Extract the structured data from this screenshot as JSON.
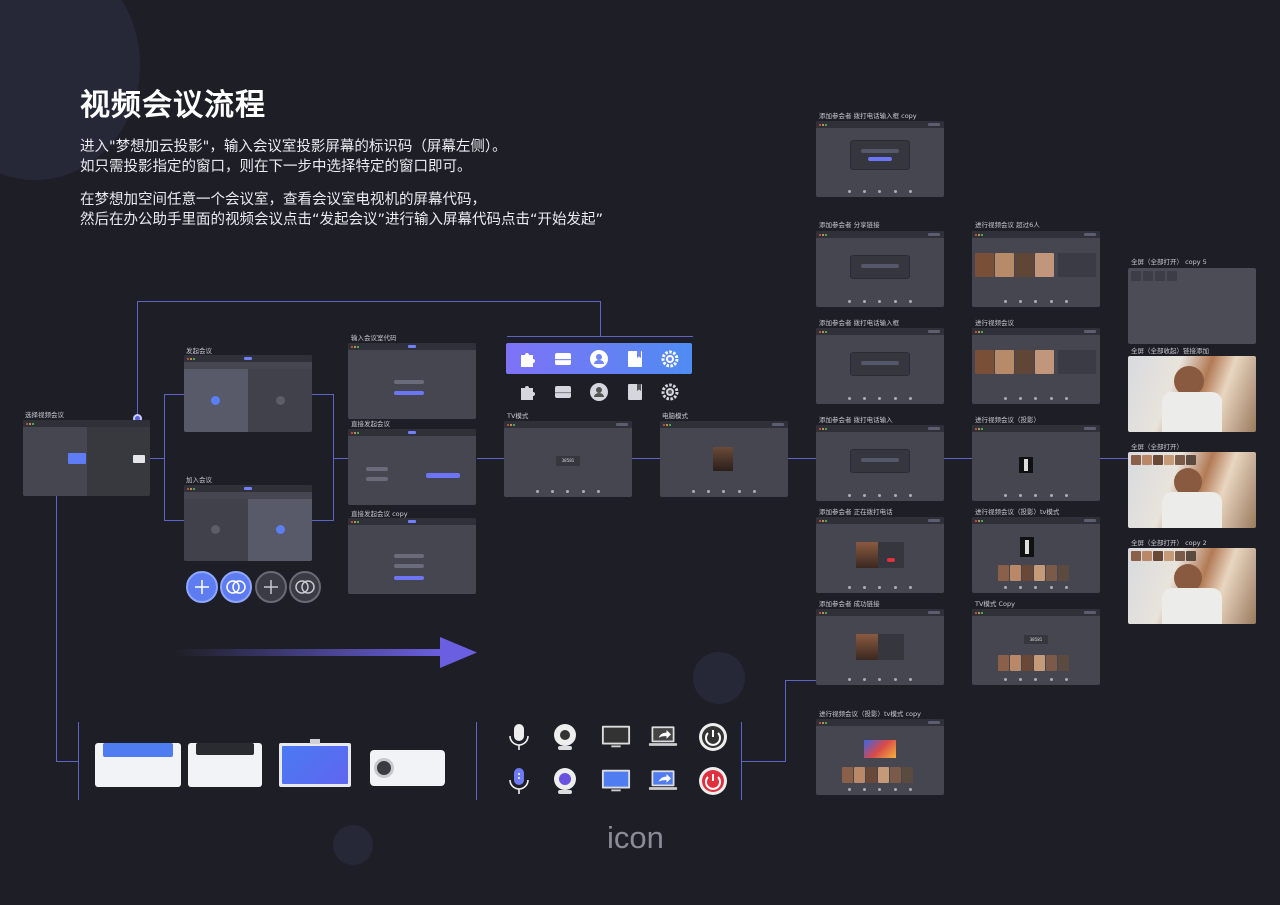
{
  "heading": {
    "title": "视频会议流程",
    "line1": "进入\"梦想加云投影\"，输入会议室投影屏幕的标识码（屏幕左侧）。",
    "line2": "如只需投影指定的窗口，则在下一步中选择特定的窗口即可。",
    "line3": "在梦想加空间任意一个会议室，查看会议室电视机的屏幕代码，",
    "line4": "然后在办公助手里面的视频会议点击“发起会议”进行输入屏幕代码点击“开始发起”"
  },
  "screens": {
    "select_meeting": "选择视频会议",
    "start_meeting": "发起会议",
    "join_meeting": "加入会议",
    "input_code": "输入会议室代码",
    "direct_start": "直接发起会议",
    "direct_start_copy": "直接发起会议 copy",
    "tv_mode": "TV模式",
    "pc_mode": "电脑模式",
    "add_dial_copy": "添加参会者 拨打电话输入框 copy",
    "add_share_link": "添加参会者 分享链接",
    "add_dial_box": "添加参会者 拨打电话输入框",
    "add_dial_input": "添加参会者 拨打电话输入",
    "add_dialing": "添加参会者 正在拨打电话",
    "add_link_success": "添加参会者 成功链接",
    "meeting_over6": "进行视频会议 超过6人",
    "meeting": "进行视频会议",
    "meeting_projection": "进行视频会议（投影）",
    "meeting_projection_tv": "进行视频会议（投影）tv模式",
    "tv_mode_copy": "TV模式 Copy",
    "meeting_projection_tv_copy": "进行视频会议（投影）tv模式 copy",
    "fullscreen_open_copy5": "全屏（全部打开） copy 5",
    "fullscreen_collapsed_link": "全屏（全部收起）链接添加",
    "fullscreen_open": "全屏（全部打开）",
    "fullscreen_open_copy2": "全屏（全部打开） copy 2"
  },
  "screen_ui": {
    "code": "38581"
  },
  "footer": {
    "icon_label": "icon"
  },
  "colors": {
    "background": "#1e1f26",
    "accent": "#5963e6",
    "toolbar_gradient_start": "#7e72f6",
    "toolbar_gradient_end": "#4f8cf3",
    "power_red": "#e0303d"
  },
  "icons": {
    "toolbar": [
      "puzzle-icon",
      "tray-icon",
      "user-icon",
      "bookmark-icon",
      "gear-icon"
    ],
    "footer_row": [
      "microphone-icon",
      "webcam-icon",
      "monitor-icon",
      "laptop-share-icon",
      "power-icon"
    ],
    "devices": [
      "printer-blue-device",
      "printer-gray-device",
      "tv-display-device",
      "projector-device"
    ],
    "round_buttons": [
      "add-circle-icon",
      "join-circle-icon",
      "add-outline-icon",
      "join-outline-icon"
    ]
  }
}
